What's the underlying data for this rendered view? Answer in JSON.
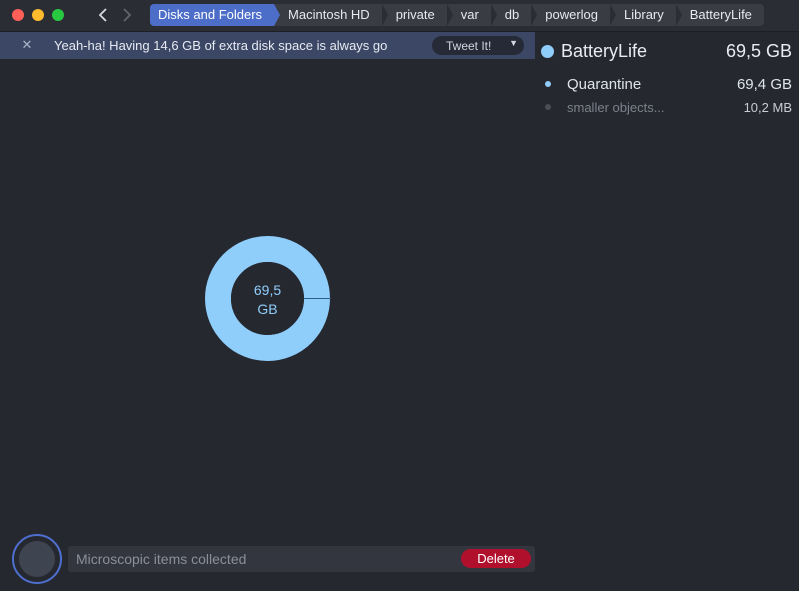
{
  "breadcrumbs": [
    "Disks and Folders",
    "Macintosh HD",
    "private",
    "var",
    "db",
    "powerlog",
    "Library",
    "BatteryLife"
  ],
  "banner": {
    "text": "Yeah-ha! Having 14,6 GB of extra disk space is always go",
    "tweet_label": "Tweet It!"
  },
  "selected": {
    "name": "BatteryLife",
    "size": "69,5 GB"
  },
  "items": [
    {
      "name": "Quarantine",
      "size": "69,4 GB"
    },
    {
      "name": "smaller objects...",
      "size": "10,2  MB"
    }
  ],
  "donut": {
    "line1": "69,5",
    "line2": "GB",
    "fill_fraction": 0.9998
  },
  "bottom": {
    "collected_text": "Microscopic items collected",
    "delete_label": "Delete"
  },
  "colors": {
    "accent": "#4c6ec8",
    "segment": "#8fcdfb",
    "delete": "#b0102c"
  }
}
